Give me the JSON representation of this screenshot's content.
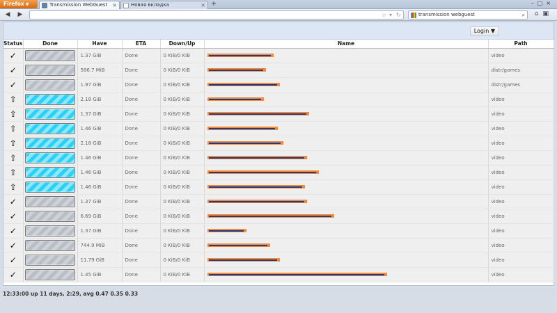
{
  "browser": {
    "app_button": "Firefox",
    "tabs": [
      {
        "label": "Transmission WebGuest",
        "active": true
      },
      {
        "label": "Новая вкладка",
        "active": false
      }
    ],
    "new_tab": "+",
    "search_value": "transmission webguest"
  },
  "app": {
    "login_label": "Login ▼"
  },
  "table": {
    "headers": {
      "status": "Status",
      "done": "Done",
      "have": "Have",
      "eta": "ETA",
      "downup": "Down/Up",
      "name": "Name",
      "path": "Path"
    },
    "rows": [
      {
        "status_icon": "check-icon",
        "status": "✓",
        "bar": "seed",
        "have": "1.37 GiB",
        "eta": "Done",
        "downup": "0 KiB/0 KiB",
        "name_len": 0.34,
        "path": "video"
      },
      {
        "status_icon": "check-icon",
        "status": "✓",
        "bar": "seed",
        "have": "586.7 MiB",
        "eta": "Done",
        "downup": "0 KiB/0 KiB",
        "name_len": 0.3,
        "path": "distr/games"
      },
      {
        "status_icon": "check-icon",
        "status": "✓",
        "bar": "seed",
        "have": "1.97 GiB",
        "eta": "Done",
        "downup": "0 KiB/0 KiB",
        "name_len": 0.37,
        "path": "distr/games"
      },
      {
        "status_icon": "upload-arrow-icon",
        "status": "⇧",
        "bar": "upload",
        "have": "2.18 GiB",
        "eta": "Done",
        "downup": "0 KiB/0 KiB",
        "name_len": 0.29,
        "path": "video"
      },
      {
        "status_icon": "upload-arrow-icon",
        "status": "⇧",
        "bar": "upload",
        "have": "1.37 GiB",
        "eta": "Done",
        "downup": "0 KiB/0 KiB",
        "name_len": 0.52,
        "path": "video"
      },
      {
        "status_icon": "upload-arrow-icon",
        "status": "⇧",
        "bar": "upload",
        "have": "1.46 GiB",
        "eta": "Done",
        "downup": "0 KiB/0 KiB",
        "name_len": 0.36,
        "path": "video"
      },
      {
        "status_icon": "upload-arrow-icon",
        "status": "⇧",
        "bar": "upload",
        "have": "2.18 GiB",
        "eta": "Done",
        "downup": "0 KiB/0 KiB",
        "name_len": 0.39,
        "path": "video"
      },
      {
        "status_icon": "upload-arrow-icon",
        "status": "⇧",
        "bar": "upload",
        "have": "1.46 GiB",
        "eta": "Done",
        "downup": "0 KiB/0 KiB",
        "name_len": 0.51,
        "path": "video"
      },
      {
        "status_icon": "upload-arrow-icon",
        "status": "⇧",
        "bar": "upload",
        "have": "1.46 GiB",
        "eta": "Done",
        "downup": "0 KiB/0 KiB",
        "name_len": 0.57,
        "path": "video"
      },
      {
        "status_icon": "upload-arrow-icon",
        "status": "⇧",
        "bar": "upload",
        "have": "1.46 GiB",
        "eta": "Done",
        "downup": "0 KiB/0 KiB",
        "name_len": 0.5,
        "path": "video"
      },
      {
        "status_icon": "check-icon",
        "status": "✓",
        "bar": "seed",
        "have": "1.37 GiB",
        "eta": "Done",
        "downup": "0 KiB/0 KiB",
        "name_len": 0.51,
        "path": "video"
      },
      {
        "status_icon": "check-icon",
        "status": "✓",
        "bar": "seed",
        "have": "6.69 GiB",
        "eta": "Done",
        "downup": "0 KiB/0 KiB",
        "name_len": 0.65,
        "path": "video"
      },
      {
        "status_icon": "check-icon",
        "status": "✓",
        "bar": "seed",
        "have": "1.37 GiB",
        "eta": "Done",
        "downup": "0 KiB/0 KiB",
        "name_len": 0.2,
        "path": "video"
      },
      {
        "status_icon": "check-icon",
        "status": "✓",
        "bar": "seed",
        "have": "744.9 MiB",
        "eta": "Done",
        "downup": "0 KiB/0 KiB",
        "name_len": 0.32,
        "path": "video"
      },
      {
        "status_icon": "check-icon",
        "status": "✓",
        "bar": "seed",
        "have": "11.79 GiB",
        "eta": "Done",
        "downup": "0 KiB/0 KiB",
        "name_len": 0.37,
        "path": "video"
      },
      {
        "status_icon": "check-icon",
        "status": "✓",
        "bar": "seed",
        "have": "1.45 GiB",
        "eta": "Done",
        "downup": "0 KiB/0 KiB",
        "name_len": 0.92,
        "path": "video"
      }
    ]
  },
  "status_line": "12:33:00 up 11 days, 2:29, avg 0.47 0.35 0.33",
  "colors": {
    "name_highlight": "#f08a3c",
    "name_text": "#243a80",
    "upload_bar": "#2ad0f5",
    "seed_bar": "#b9bdc6"
  }
}
